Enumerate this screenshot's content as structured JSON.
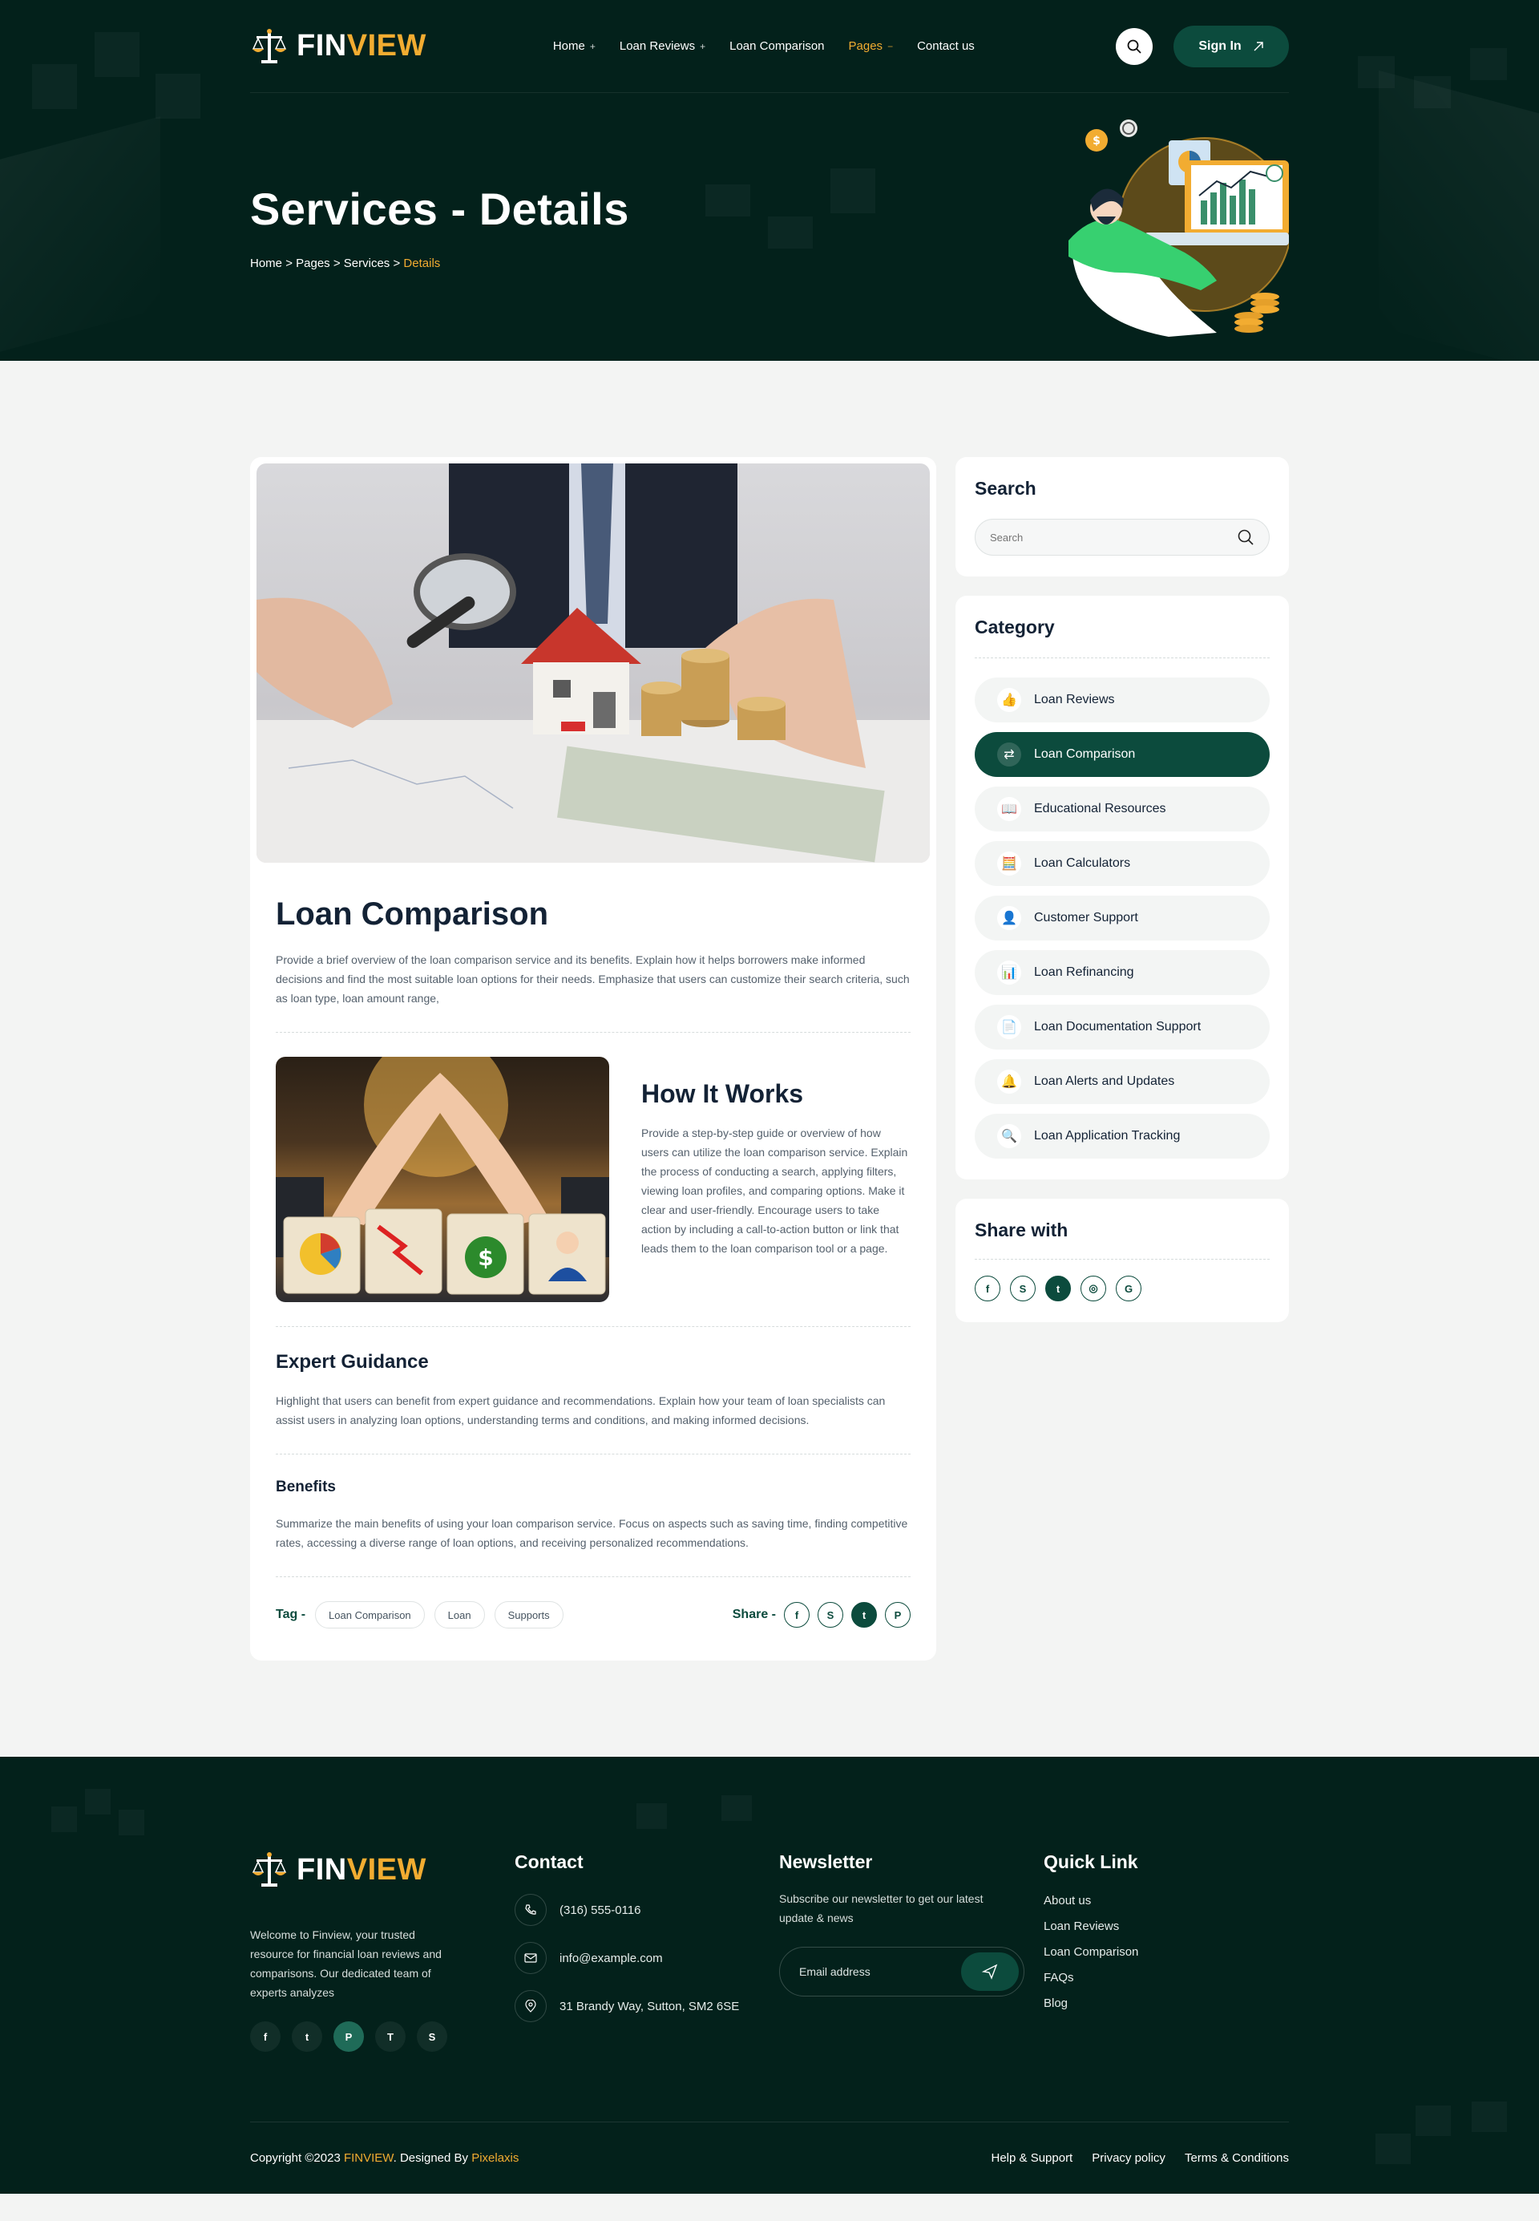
{
  "brand": {
    "name_part1": "FIN",
    "name_part2": "VIEW"
  },
  "nav": {
    "items": [
      {
        "label": "Home",
        "suffix": "+"
      },
      {
        "label": "Loan Reviews",
        "suffix": "+"
      },
      {
        "label": "Loan Comparison",
        "suffix": ""
      },
      {
        "label": "Pages",
        "suffix": "−"
      },
      {
        "label": "Contact us",
        "suffix": ""
      }
    ],
    "signin_label": "Sign In"
  },
  "hero": {
    "title": "Services - Details",
    "breadcrumb": [
      "Home",
      ">",
      "Pages",
      ">",
      "Services",
      ">",
      "Details"
    ]
  },
  "article": {
    "title": "Loan Comparison",
    "intro": "Provide a brief overview of the loan comparison service and its benefits. Explain how it helps borrowers make informed decisions and find the most suitable loan options for their needs. Emphasize that users can customize their search criteria, such as loan type, loan amount range,",
    "how_title": "How It Works",
    "how_text": "Provide a step-by-step guide or overview of how users can utilize the loan comparison service. Explain the process of conducting a search, applying filters, viewing loan profiles, and comparing options. Make it clear and user-friendly. Encourage users to take action by including a call-to-action button or link that leads them to the loan comparison tool or a page.",
    "expert_title": "Expert Guidance",
    "expert_text": "Highlight that users can benefit from expert guidance and recommendations. Explain how your team of loan specialists can assist users in analyzing loan options, understanding terms and conditions, and making informed decisions.",
    "benefits_title": "Benefits",
    "benefits_text": "Summarize the main benefits of using your loan comparison service. Focus on aspects such as saving time, finding competitive rates, accessing a diverse range of loan options, and receiving personalized recommendations.",
    "tag_label": "Tag -",
    "tags": [
      "Loan Comparison",
      "Loan",
      "Supports"
    ],
    "share_label": "Share -"
  },
  "sidebar": {
    "search_title": "Search",
    "search_placeholder": "Search",
    "category_title": "Category",
    "categories": [
      "Loan Reviews",
      "Loan Comparison",
      "Educational Resources",
      "Loan Calculators",
      "Customer Support",
      "Loan Refinancing",
      "Loan Documentation Support",
      "Loan Alerts and Updates",
      "Loan Application Tracking"
    ],
    "active_category": "Loan Comparison",
    "share_title": "Share with"
  },
  "footer": {
    "about": "Welcome to Finview, your trusted resource for financial loan reviews and comparisons. Our dedicated team of experts analyzes",
    "contact_title": "Contact",
    "phone": "(316) 555-0116",
    "email": "info@example.com",
    "address": "31 Brandy Way, Sutton, SM2 6SE",
    "newsletter_title": "Newsletter",
    "newsletter_text": "Subscribe our newsletter to get our latest update & news",
    "email_placeholder": "Email address",
    "quick_title": "Quick Link",
    "quick_links": [
      "About us",
      "Loan Reviews",
      "Loan Comparison",
      "FAQs",
      "Blog"
    ],
    "copyright_prefix": "Copyright ©2023",
    "copyright_brand": "FINVIEW",
    "designed_by": ". Designed By",
    "designer": "Pixelaxis",
    "bottom_links": [
      "Help & Support",
      "Privacy policy",
      "Terms & Conditions"
    ]
  },
  "colors": {
    "dark_green": "#03211b",
    "accent_green": "#0c4b3d",
    "gold": "#f2ac31"
  },
  "icons": [
    "search-icon",
    "arrow-up-right-icon",
    "facebook-icon",
    "skype-icon",
    "twitter-icon",
    "instagram-icon",
    "github-icon",
    "pinterest-icon",
    "twitch-icon",
    "phone-icon",
    "mail-icon",
    "location-icon",
    "send-icon"
  ]
}
